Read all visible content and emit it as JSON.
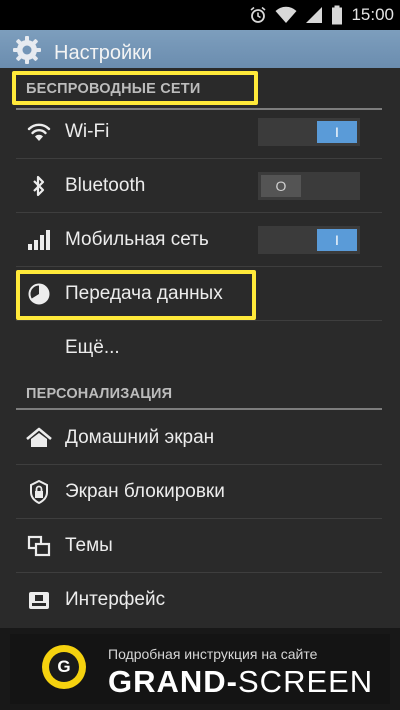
{
  "status_bar": {
    "time": "15:00",
    "icons": [
      "alarm-icon",
      "wifi-icon",
      "signal-icon",
      "battery-icon"
    ]
  },
  "action_bar": {
    "title": "Настройки",
    "icon": "gear-icon"
  },
  "sections": {
    "wireless": {
      "header": "БЕСПРОВОДНЫЕ СЕТИ",
      "items": [
        {
          "label": "Wi-Fi",
          "icon": "wifi-icon",
          "toggle": "I",
          "on": true
        },
        {
          "label": "Bluetooth",
          "icon": "bluetooth-icon",
          "toggle": "O",
          "on": false
        },
        {
          "label": "Мобильная сеть",
          "icon": "signal-icon",
          "toggle": "I",
          "on": true
        },
        {
          "label": "Передача данных",
          "icon": "data-usage-icon"
        },
        {
          "label": "Ещё..."
        }
      ]
    },
    "personalization": {
      "header": "ПЕРСОНАЛИЗАЦИЯ",
      "items": [
        {
          "label": "Домашний экран",
          "icon": "home-icon"
        },
        {
          "label": "Экран блокировки",
          "icon": "lock-icon"
        },
        {
          "label": "Темы",
          "icon": "themes-icon"
        },
        {
          "label": "Интерфейс",
          "icon": "interface-icon"
        }
      ]
    }
  },
  "footer": {
    "caption": "Подробная инструкция на сайте",
    "brand_bold": "GRAND-",
    "brand_rest": "SCREEN",
    "logo_letter": "G"
  },
  "colors": {
    "accent_toggle": "#5a9bd8",
    "highlight": "#ffe93a",
    "action_bar": "#7395b7",
    "logo": "#f5d20f"
  }
}
